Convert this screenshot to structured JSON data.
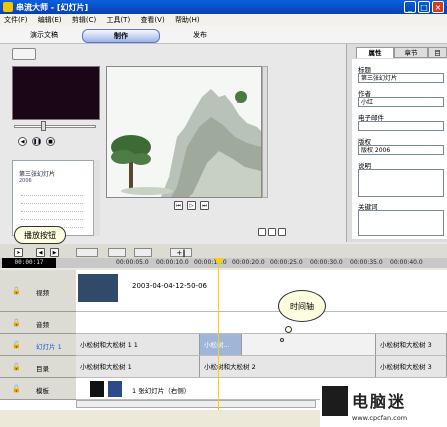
{
  "window": {
    "title": "串流大师 - [幻灯片]",
    "controls": [
      "_",
      "□",
      "×"
    ]
  },
  "menu": [
    "文件(F)",
    "编辑(E)",
    "剪辑(C)",
    "工具(T)",
    "查看(V)",
    "帮助(H)"
  ],
  "modes": [
    {
      "label": "演示文稿"
    },
    {
      "label": "制作",
      "active": true
    },
    {
      "label": "发布"
    }
  ],
  "thumbnail": {
    "title": "第三张幻灯片",
    "subtitle": "2006"
  },
  "properties": {
    "tabs": [
      "属性",
      "章节",
      "目"
    ],
    "fields": [
      {
        "label": "标题",
        "value": "第三张幻灯片"
      },
      {
        "label": "作者",
        "value": "小红"
      },
      {
        "label": "电子邮件",
        "value": ""
      },
      {
        "label": "版权",
        "value": "版权 2006"
      },
      {
        "label": "说明",
        "value": ""
      },
      {
        "label": "关键词",
        "value": ""
      }
    ]
  },
  "timeline": {
    "timecode": "00:00:17",
    "ruler": [
      "00:00:05.0",
      "00:00:10.0",
      "00:00:15.0",
      "00:00:20.0",
      "00:00:25.0",
      "00:00:30.0",
      "00:00:35.0",
      "00:00:40.0"
    ],
    "tracks": [
      {
        "label": "视频",
        "clips": [
          {
            "text": "2003-04-04-12-50-06"
          }
        ]
      },
      {
        "label": "音频",
        "clips": []
      },
      {
        "label": "幻灯片 1",
        "clips": [
          {
            "text": "小松树和大松树 1 1"
          },
          {
            "text": "小松树..."
          },
          {
            "text": "小松树和大松树 3"
          }
        ]
      },
      {
        "label": "目录",
        "clips": [
          {
            "text": "小松树和大松树 1"
          },
          {
            "text": "小松树和大松树 2"
          },
          {
            "text": "小松树和大松树 3"
          }
        ]
      },
      {
        "label": "模板",
        "clips": [
          {
            "text": "1 张幻灯片（右侧）"
          }
        ]
      }
    ]
  },
  "callouts": {
    "play_button": "播放按钮",
    "timeline_axis": "时间轴"
  },
  "watermark": {
    "text": "电脑迷",
    "url": "www.cpcfan.com"
  }
}
